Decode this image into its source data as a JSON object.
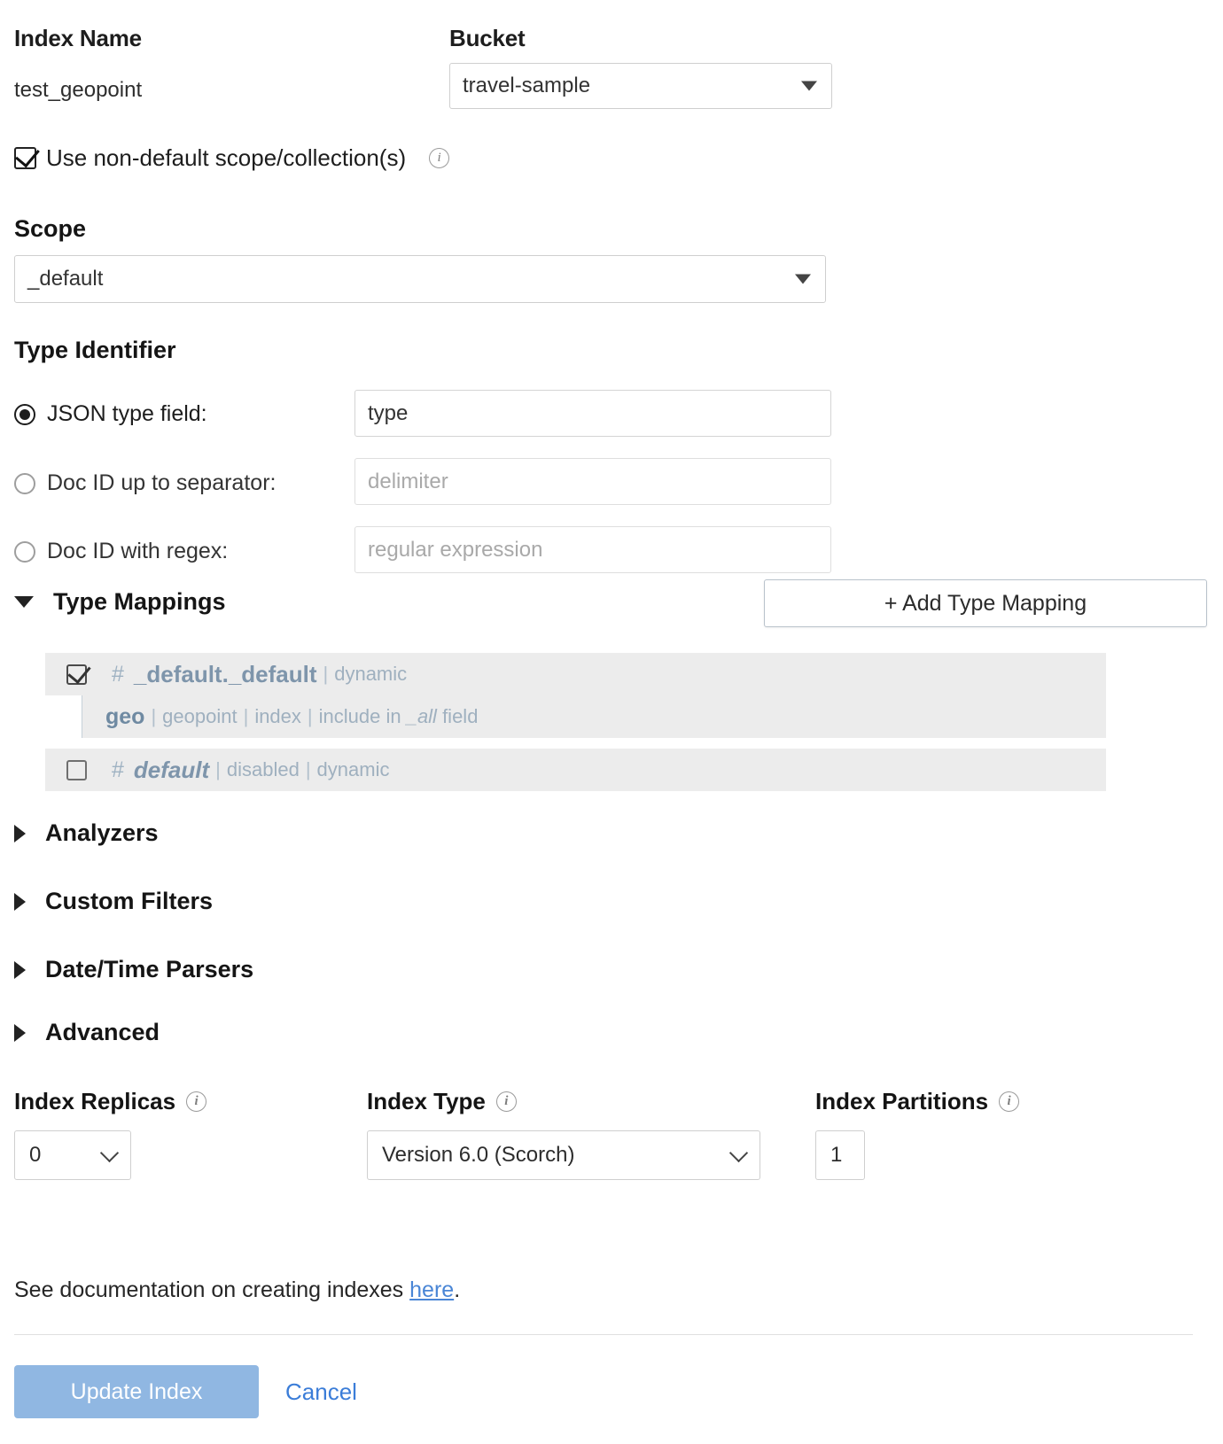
{
  "form": {
    "index_name_label": "Index Name",
    "index_name_value": "test_geopoint",
    "bucket_label": "Bucket",
    "bucket_value": "travel-sample",
    "non_default_scope_label": "Use non-default scope/collection(s)",
    "scope_label": "Scope",
    "scope_value": "_default"
  },
  "type_identifier": {
    "title": "Type Identifier",
    "options": [
      {
        "label": "JSON type field:",
        "value": "type",
        "placeholder": "",
        "selected": true
      },
      {
        "label": "Doc ID up to separator:",
        "value": "",
        "placeholder": "delimiter",
        "selected": false
      },
      {
        "label": "Doc ID with regex:",
        "value": "",
        "placeholder": "regular expression",
        "selected": false
      }
    ]
  },
  "type_mappings": {
    "title": "Type Mappings",
    "add_button_label": "+ Add Type Mapping",
    "rows": [
      {
        "kind": "mapping",
        "checked": true,
        "hash": "#",
        "name": "_default._default",
        "italic": false,
        "meta": [
          "dynamic"
        ]
      },
      {
        "kind": "field",
        "name": "geo",
        "meta_raw": "| geopoint | index | include in _all field",
        "meta": [
          "geopoint",
          "index",
          "include in _all field"
        ]
      },
      {
        "kind": "mapping",
        "checked": false,
        "hash": "#",
        "name": "default",
        "italic": true,
        "meta": [
          "disabled",
          "dynamic"
        ]
      }
    ]
  },
  "sections": [
    {
      "label": "Analyzers",
      "expanded": false
    },
    {
      "label": "Custom Filters",
      "expanded": false
    },
    {
      "label": "Date/Time Parsers",
      "expanded": false
    },
    {
      "label": "Advanced",
      "expanded": false
    }
  ],
  "settings": {
    "replicas_label": "Index Replicas",
    "replicas_value": "0",
    "type_label": "Index Type",
    "type_value": "Version 6.0 (Scorch)",
    "partitions_label": "Index Partitions",
    "partitions_value": "1"
  },
  "footer": {
    "doc_prefix": "See documentation on creating indexes ",
    "doc_link": "here",
    "doc_suffix": ".",
    "update_label": "Update Index",
    "cancel_label": "Cancel"
  },
  "colors": {
    "primary_button": "#90b7e2",
    "link": "#3b7dd8",
    "mapping_text": "#7e95ab",
    "row_background": "#ececec"
  }
}
